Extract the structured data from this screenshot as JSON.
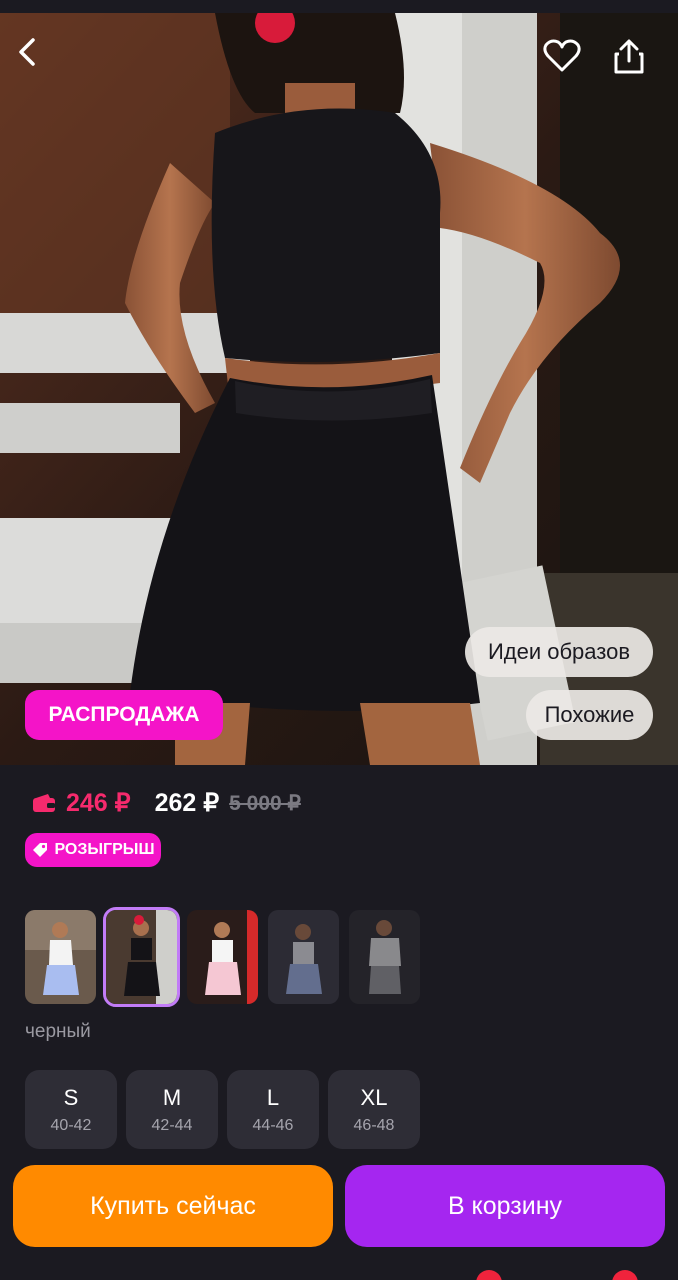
{
  "product": {
    "image_alt": "product-photo-black-crop-top-and-shorts",
    "sale_badge": "РАСПРОДАЖА",
    "ideas_label": "Идеи образов",
    "similar_label": "Похожие"
  },
  "price": {
    "wallet_price": "246 ₽",
    "regular_price": "262 ₽",
    "old_price": "5 000 ₽",
    "raffle_label": "РОЗЫГРЫШ"
  },
  "colors": {
    "selected_label": "черный",
    "options": [
      "белый",
      "черный",
      "розовый",
      "голубой",
      "серый"
    ]
  },
  "sizes": [
    {
      "name": "S",
      "range": "40-42"
    },
    {
      "name": "M",
      "range": "42-44"
    },
    {
      "name": "L",
      "range": "44-46"
    },
    {
      "name": "XL",
      "range": "46-48"
    }
  ],
  "actions": {
    "buy_now": "Купить сейчас",
    "add_to_cart": "В корзину"
  },
  "icons": {
    "back": "chevron-left-icon",
    "favorite": "heart-icon",
    "share": "share-icon",
    "wallet": "wallet-icon",
    "raffle": "tag-icon"
  },
  "theme": {
    "accent_pink": "#f414c8",
    "price_red": "#f62a6d",
    "buy_orange": "#ff8a00",
    "cart_purple": "#a526f0",
    "background": "#1b1a21"
  }
}
